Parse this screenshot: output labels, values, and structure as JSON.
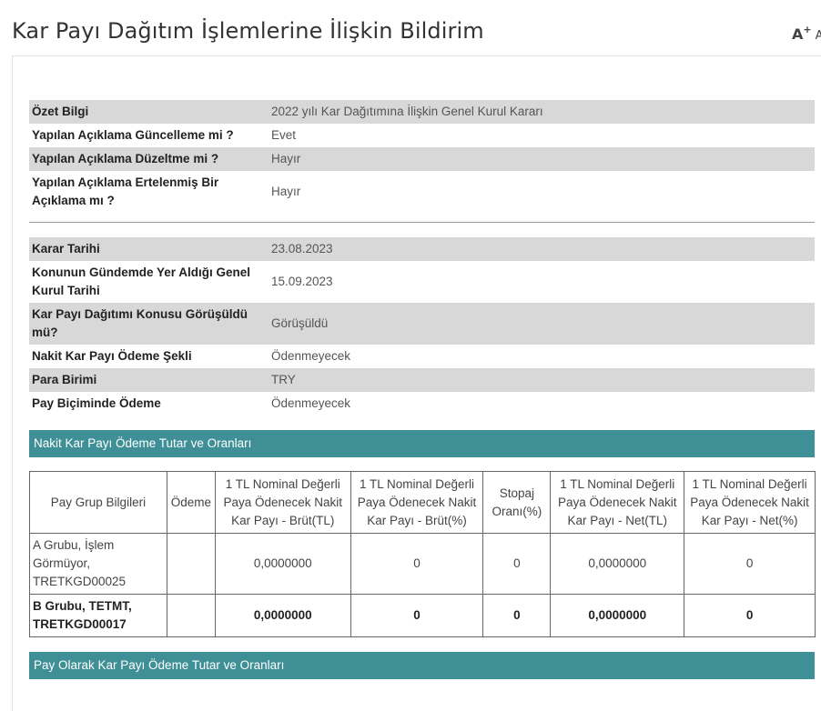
{
  "title": "Kar Payı Dağıtım İşlemlerine İlişkin Bildirim",
  "font_control": {
    "large": "A",
    "sup": "+",
    "small": "A"
  },
  "summary": [
    {
      "label": "Özet Bilgi",
      "value": "2022 yılı Kar Dağıtımına İlişkin Genel Kurul Kararı"
    },
    {
      "label": "Yapılan Açıklama Güncelleme mi ?",
      "value": "Evet"
    },
    {
      "label": "Yapılan Açıklama Düzeltme mi ?",
      "value": "Hayır"
    },
    {
      "label": "Yapılan Açıklama Ertelenmiş Bir Açıklama mı ?",
      "value": "Hayır"
    }
  ],
  "decision": [
    {
      "label": "Karar Tarihi",
      "value": "23.08.2023"
    },
    {
      "label": "Konunun Gündemde Yer Aldığı Genel Kurul Tarihi",
      "value": "15.09.2023"
    },
    {
      "label": "Kar Payı Dağıtımı Konusu Görüşüldü mü?",
      "value": "Görüşüldü"
    },
    {
      "label": "Nakit Kar Payı Ödeme Şekli",
      "value": "Ödenmeyecek"
    },
    {
      "label": "Para Birimi",
      "value": "TRY"
    },
    {
      "label": "Pay Biçiminde Ödeme",
      "value": "Ödenmeyecek"
    }
  ],
  "cash_section_title": "Nakit Kar Payı Ödeme Tutar ve Oranları",
  "dividend_table": {
    "headers": [
      "Pay Grup Bilgileri",
      "Ödeme",
      "1 TL Nominal Değerli Paya Ödenecek Nakit Kar Payı - Brüt(TL)",
      "1 TL Nominal Değerli Paya Ödenecek Nakit Kar Payı - Brüt(%)",
      "Stopaj Oranı(%)",
      "1 TL Nominal Değerli Paya Ödenecek Nakit Kar Payı - Net(TL)",
      "1 TL Nominal Değerli Paya Ödenecek Nakit Kar Payı - Net(%)"
    ],
    "rows": [
      [
        "A Grubu, İşlem Görmüyor, TRETKGD00025",
        "",
        "0,0000000",
        "0",
        "0",
        "0,0000000",
        "0"
      ],
      [
        "B Grubu, TETMT, TRETKGD00017",
        "",
        "0,0000000",
        "0",
        "0",
        "0,0000000",
        "0"
      ]
    ]
  },
  "stock_section_title": "Pay Olarak Kar Payı Ödeme Tutar ve Oranları"
}
